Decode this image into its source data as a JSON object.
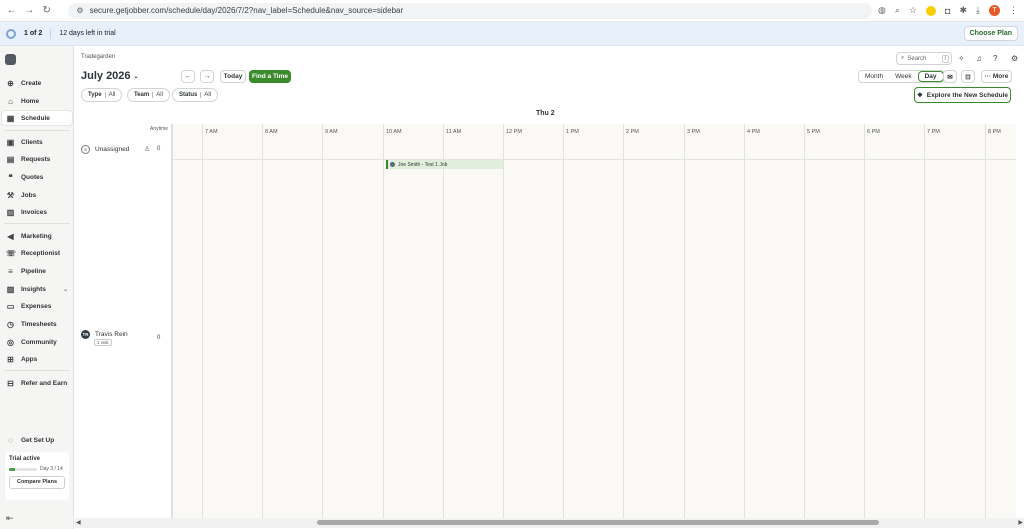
{
  "browser": {
    "url": "secure.getjobber.com/schedule/day/2026/7/2?nav_label=Schedule&nav_source=sidebar",
    "profile_initial": "T"
  },
  "banner": {
    "count": "1 of 2",
    "text": "12 days left in trial",
    "choose_plan": "Choose Plan"
  },
  "sidebar": {
    "items": [
      {
        "label": "Create",
        "icon": "plus-circle-icon",
        "glyph": "⊕"
      },
      {
        "label": "Home",
        "icon": "home-icon",
        "glyph": "⌂"
      },
      {
        "label": "Schedule",
        "icon": "calendar-icon",
        "glyph": "▦"
      },
      {
        "label": "Clients",
        "icon": "clients-icon",
        "glyph": "▣"
      },
      {
        "label": "Requests",
        "icon": "requests-icon",
        "glyph": "▤"
      },
      {
        "label": "Quotes",
        "icon": "quotes-icon",
        "glyph": "❝"
      },
      {
        "label": "Jobs",
        "icon": "wrench-icon",
        "glyph": "⚒"
      },
      {
        "label": "Invoices",
        "icon": "invoice-icon",
        "glyph": "▥"
      },
      {
        "label": "Marketing",
        "icon": "megaphone-icon",
        "glyph": "◀"
      },
      {
        "label": "Receptionist",
        "icon": "receptionist-icon",
        "glyph": "☏"
      },
      {
        "label": "Pipeline",
        "icon": "pipeline-icon",
        "glyph": "≡"
      },
      {
        "label": "Insights",
        "icon": "insights-icon",
        "glyph": "▨"
      },
      {
        "label": "Expenses",
        "icon": "expenses-icon",
        "glyph": "▭"
      },
      {
        "label": "Timesheets",
        "icon": "clock-icon",
        "glyph": "◷"
      },
      {
        "label": "Community",
        "icon": "community-icon",
        "glyph": "◎"
      },
      {
        "label": "Apps",
        "icon": "apps-icon",
        "glyph": "⊞"
      },
      {
        "label": "Refer and Earn",
        "icon": "gift-icon",
        "glyph": "⊟"
      },
      {
        "label": "Get Set Up",
        "icon": "progress-ring-icon",
        "glyph": "◌"
      }
    ],
    "trial": {
      "title": "Trial active",
      "day": "Day 3 / 14",
      "progress": 0.21,
      "compare": "Compare Plans"
    }
  },
  "header": {
    "breadcrumb": "Tradegarden",
    "month": "July 2026",
    "today": "Today",
    "find_time": "Find a Time",
    "search_placeholder": "Search",
    "search_shortcut": "/",
    "filters": [
      {
        "label": "Type",
        "value": "All"
      },
      {
        "label": "Team",
        "value": "All"
      },
      {
        "label": "Status",
        "value": "All"
      }
    ],
    "views": [
      "Month",
      "Week",
      "Day"
    ],
    "active_view": "Day",
    "more": "··· More",
    "explore": "Explore the New Schedule"
  },
  "calendar": {
    "day": "Thu 2",
    "anytime": "Anytime",
    "hours": [
      "7 AM",
      "8 AM",
      "9 AM",
      "10 AM",
      "11 AM",
      "12 PM",
      "1 PM",
      "2 PM",
      "3 PM",
      "4 PM",
      "5 PM",
      "6 PM",
      "7 PM",
      "8 PM"
    ],
    "rows": [
      {
        "name": "Unassigned",
        "count": "0"
      },
      {
        "name": "Travis Rein",
        "initials": "TR",
        "count": "0",
        "visits": "1 visit"
      }
    ],
    "event": {
      "label": "Joe Smith - Test 1 Job"
    }
  },
  "colors": {
    "accent": "#3b8a2c",
    "banner": "#e8f0fb",
    "sidebar": "#f5f5f3"
  }
}
